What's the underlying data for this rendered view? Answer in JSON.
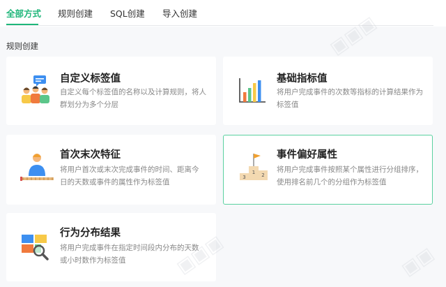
{
  "tabs": [
    {
      "label": "全部方式",
      "active": true
    },
    {
      "label": "规则创建",
      "active": false
    },
    {
      "label": "SQL创建",
      "active": false
    },
    {
      "label": "导入创建",
      "active": false
    }
  ],
  "section_title": "规则创建",
  "cards": [
    {
      "title": "自定义标签值",
      "desc": "自定义每个标签值的名称以及计算规则，将人群划分为多个分层",
      "icon": "people-group-icon",
      "selected": false
    },
    {
      "title": "基础指标值",
      "desc": "将用户完成事件的次数等指标的计算结果作为标签值",
      "icon": "bar-chart-icon",
      "selected": false
    },
    {
      "title": "首次末次特征",
      "desc": "将用户首次或末次完成事件的时间、距离今日的天数或事件的属性作为标签值",
      "icon": "person-timeline-icon",
      "selected": false
    },
    {
      "title": "事件偏好属性",
      "desc": "将用户完成事件按照某个属性进行分组排序，使用排名前几个的分组作为标签值",
      "icon": "podium-icon",
      "selected": true
    },
    {
      "title": "行为分布结果",
      "desc": "将用户完成事件在指定时间段内分布的天数或小时数作为标签值",
      "icon": "blocks-magnifier-icon",
      "selected": false
    }
  ],
  "podium_labels": [
    "1",
    "2",
    "3"
  ],
  "colors": {
    "accent": "#1fb67a",
    "selected_border": "#5ad1a0"
  }
}
